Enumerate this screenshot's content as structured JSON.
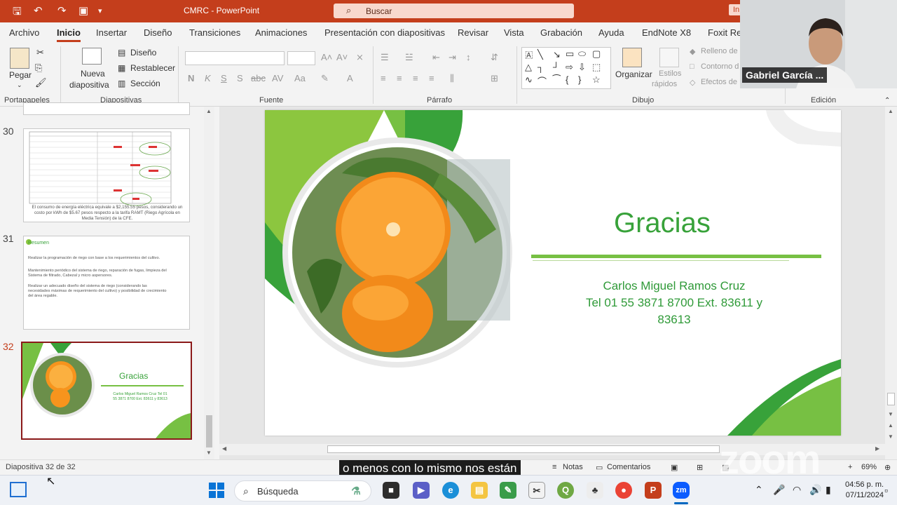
{
  "app": {
    "title": "CMRC  -  PowerPoint",
    "search_label": "Buscar",
    "title_right_label": "In"
  },
  "tabs": [
    "Archivo",
    "Inicio",
    "Insertar",
    "Diseño",
    "Transiciones",
    "Animaciones",
    "Presentación con diapositivas",
    "Revisar",
    "Vista",
    "Grabación",
    "Ayuda",
    "EndNote X8",
    "Foxit Rea"
  ],
  "ribbon": {
    "portapapeles": {
      "label": "Portapapeles",
      "pegar": "Pegar"
    },
    "diapositivas": {
      "label": "Diapositivas",
      "nueva": "Nueva",
      "nueva2": "diapositiva",
      "diseno": "Diseño",
      "restablecer": "Restablecer",
      "seccion": "Sección"
    },
    "fuente": {
      "label": "Fuente",
      "bold": "N",
      "italic": "K",
      "underline": "S",
      "strike": "S"
    },
    "parrafo": {
      "label": "Párrafo"
    },
    "dibujo": {
      "label": "Dibujo",
      "organizar": "Organizar",
      "estilos": "Estilos",
      "rapidos": "rápidos",
      "relleno": "Relleno de",
      "contorno": "Contorno d",
      "efectos": "Efectos de"
    },
    "edicion": {
      "label": "Edición"
    }
  },
  "thumbnails": [
    {
      "num": "30",
      "text": "El consumo de energía eléctrica equivale a $2,155.55 pesos, considerando un costo por kWh de $5.67 pesos respecto a la tarifa RAMT (Riego Agrícola en Media Tensión) de la CFE."
    },
    {
      "num": "31",
      "title": "Resumen",
      "bullets": [
        "Realizar la programación de riego con base a los requerimientos del cultivo.",
        "Mantenimiento periódico del sistema de riego, reparación de fugas, limpieza del Sistema de filtrado, Cabezal y micro aspersores.",
        "Realizar un adecuado diseño del sistema de riego (considerando las necesidades máximas de requerimiento del cultivo) y posibilidad de crecimiento del área regable."
      ]
    },
    {
      "num": "32",
      "title": "Gracias",
      "contact": "Carlos Miguel Ramos Cruz Tel 01 55 3871 8700 Ext. 83611 y 83613"
    }
  ],
  "slide": {
    "title": "Gracias",
    "name": "Carlos Miguel Ramos Cruz",
    "phone": "Tel 01 55 3871 8700 Ext. 83611 y",
    "ext": "83613"
  },
  "status": {
    "slide_counter": "Diapositiva 32 de 32",
    "notas": "Notas",
    "comentarios": "Comentarios",
    "zoom": "69%",
    "caption": "o menos con lo mismo nos están",
    "watermark": "zoom"
  },
  "video": {
    "participant": "Gabriel García ..."
  },
  "taskbar": {
    "search": "Búsqueda",
    "time": "04:56 p. m.",
    "date": "07/11/2024"
  },
  "colors": {
    "accent": "#c43e1c",
    "slide_green": "#38a23a",
    "light_green": "#77c043"
  }
}
